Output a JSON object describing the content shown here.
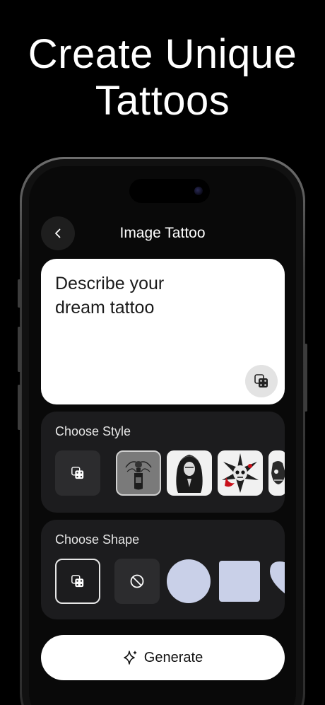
{
  "headline": {
    "line1": "Create Unique",
    "line2": "Tattoos"
  },
  "nav": {
    "title": "Image Tattoo",
    "back_icon": "chevron-left-icon"
  },
  "prompt": {
    "placeholder": "Describe your dream tattoo",
    "random_icon": "dice-icon"
  },
  "style_section": {
    "title": "Choose Style",
    "items": [
      "random",
      "bottle-rose",
      "praying-nun",
      "skull-star",
      "skull-partial"
    ],
    "selected": "bottle-rose"
  },
  "shape_section": {
    "title": "Choose Shape",
    "items": [
      "random",
      "none",
      "circle",
      "square",
      "heart"
    ],
    "selected": "random",
    "shape_color": "#c9d0e8"
  },
  "generate": {
    "label": "Generate",
    "icon": "sparkle-icon"
  },
  "colors": {
    "background": "#000000",
    "card": "#1c1c1e",
    "accent_red": "#c8101a"
  }
}
